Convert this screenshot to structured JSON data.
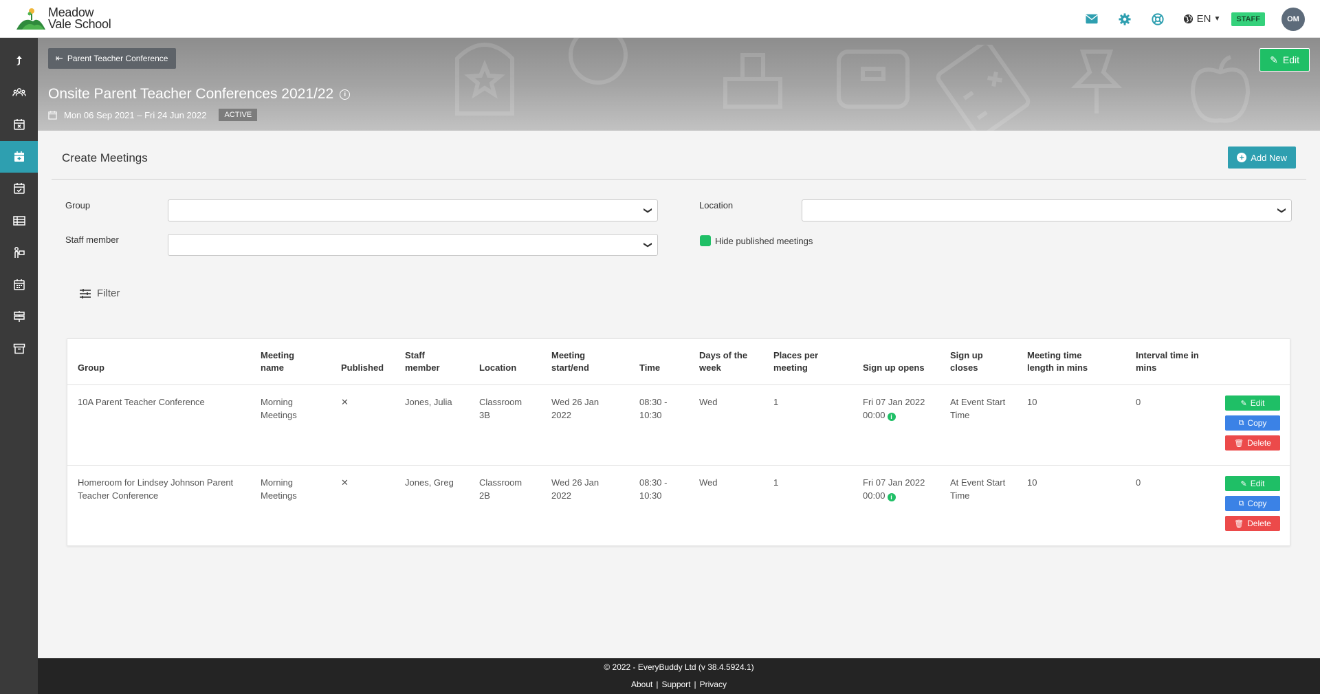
{
  "brand": {
    "name_line1": "Meadow",
    "name_line2": "Vale School"
  },
  "header": {
    "language": "EN",
    "role_badge": "STAFF",
    "avatar_initials": "OM"
  },
  "banner": {
    "back_label": "Parent Teacher Conference",
    "title": "Onsite Parent Teacher Conferences 2021/22",
    "dates": "Mon 06 Sep 2021 – Fri 24 Jun 2022",
    "status": "ACTIVE",
    "edit_label": "Edit"
  },
  "section": {
    "title": "Create Meetings",
    "add_new_label": "Add New"
  },
  "filters": {
    "group_label": "Group",
    "group_value": "",
    "location_label": "Location",
    "location_value": "",
    "staff_label": "Staff member",
    "staff_value": "",
    "hide_published_label": "Hide published meetings",
    "hide_published_checked": true,
    "filter_label": "Filter"
  },
  "table": {
    "headers": {
      "group": "Group",
      "meeting_name": "Meeting name",
      "published": "Published",
      "staff": "Staff member",
      "location": "Location",
      "start_end": "Meeting start/end",
      "time": "Time",
      "days": "Days of the week",
      "places": "Places per meeting",
      "signup_opens": "Sign up opens",
      "signup_closes": "Sign up closes",
      "length": "Meeting time length in mins",
      "interval": "Interval time in mins"
    },
    "rows": [
      {
        "group": "10A Parent Teacher Conference",
        "meeting_name": "Morning Meetings",
        "published": "✕",
        "staff": "Jones, Julia",
        "location": "Classroom 3B",
        "start_end": "Wed 26 Jan 2022",
        "time": "08:30 - 10:30",
        "days": "Wed",
        "places": "1",
        "signup_opens": "Fri 07 Jan 2022 00:00",
        "signup_closes": "At Event Start Time",
        "length": "10",
        "interval": "0"
      },
      {
        "group": "Homeroom for Lindsey Johnson Parent Teacher Conference",
        "meeting_name": "Morning Meetings",
        "published": "✕",
        "staff": "Jones, Greg",
        "location": "Classroom 2B",
        "start_end": "Wed 26 Jan 2022",
        "time": "08:30 - 10:30",
        "days": "Wed",
        "places": "1",
        "signup_opens": "Fri 07 Jan 2022 00:00",
        "signup_closes": "At Event Start Time",
        "length": "10",
        "interval": "0"
      }
    ],
    "actions": {
      "edit": "Edit",
      "copy": "Copy",
      "delete": "Delete"
    }
  },
  "footer": {
    "copyright": "© 2022 - EveryBuddy Ltd (v 38.4.5924.1)",
    "links": [
      "About",
      "Support",
      "Privacy"
    ]
  },
  "colors": {
    "accent": "#2e9fb0",
    "success": "#1fbf66",
    "primary": "#3b82e6",
    "danger": "#ec4a4a",
    "sidebar": "#3a3a3a"
  },
  "icons": {
    "header": [
      "mail-icon",
      "gear-icon",
      "lifebuoy-icon",
      "globe-icon"
    ],
    "sidebar": [
      "upload-icon",
      "users-icon",
      "calendar-cancel-icon",
      "calendar-add-icon",
      "calendar-check-icon",
      "table-icon",
      "person-board-icon",
      "calendar-grid-icon",
      "signpost-icon",
      "archive-icon"
    ]
  }
}
